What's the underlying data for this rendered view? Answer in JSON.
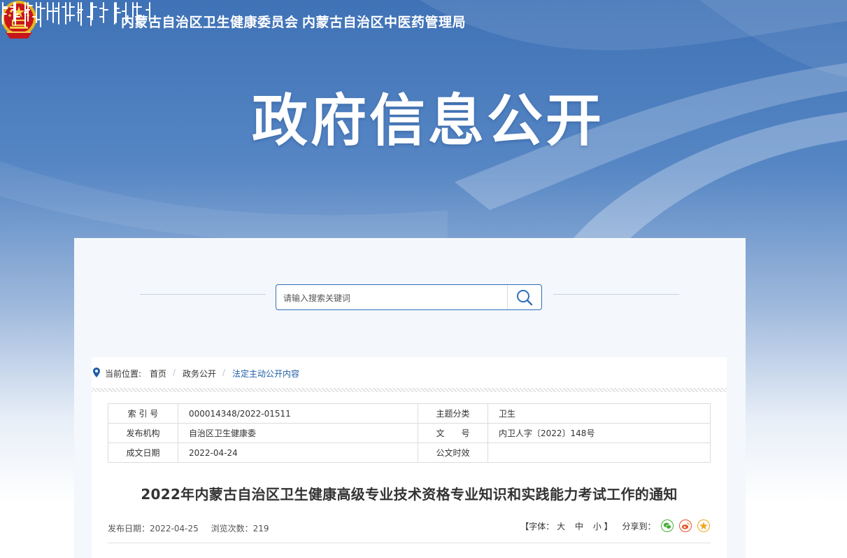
{
  "header": {
    "org_name_1": "内蒙古自治区卫生健康委员会",
    "org_name_2": "内蒙古自治区中医药管理局",
    "section_title": "政府信息公开"
  },
  "search": {
    "placeholder": "请输入搜索关键词"
  },
  "breadcrumb": {
    "label": "当前位置:",
    "items": [
      "首页",
      "政务公开",
      "法定主动公开内容"
    ],
    "separator": "/"
  },
  "meta": {
    "rows": [
      {
        "k1": "索 引 号",
        "v1": "000014348/2022-01511",
        "k2": "主题分类",
        "v2": "卫生"
      },
      {
        "k1": "发布机构",
        "v1": "自治区卫生健康委",
        "k2": "文　　号",
        "v2": "内卫人字〔2022〕148号"
      },
      {
        "k1": "成文日期",
        "v1": "2022-04-24",
        "k2": "公文时效",
        "v2": ""
      }
    ]
  },
  "article": {
    "title": "2022年内蒙古自治区卫生健康高级专业技术资格专业知识和实践能力考试工作的通知",
    "publish_date": "发布日期：2022-04-25",
    "views": "浏览次数：219"
  },
  "tools": {
    "font_label": "【字体：",
    "font_large": "大",
    "font_medium": "中",
    "font_small": "小",
    "font_close": "】",
    "share_label": "分享到："
  },
  "colors": {
    "accent": "#1f5ea8",
    "hero_top": "#3f72b6",
    "wechat": "#45b035",
    "weibo": "#e6512a",
    "favorite": "#f2a61f"
  }
}
